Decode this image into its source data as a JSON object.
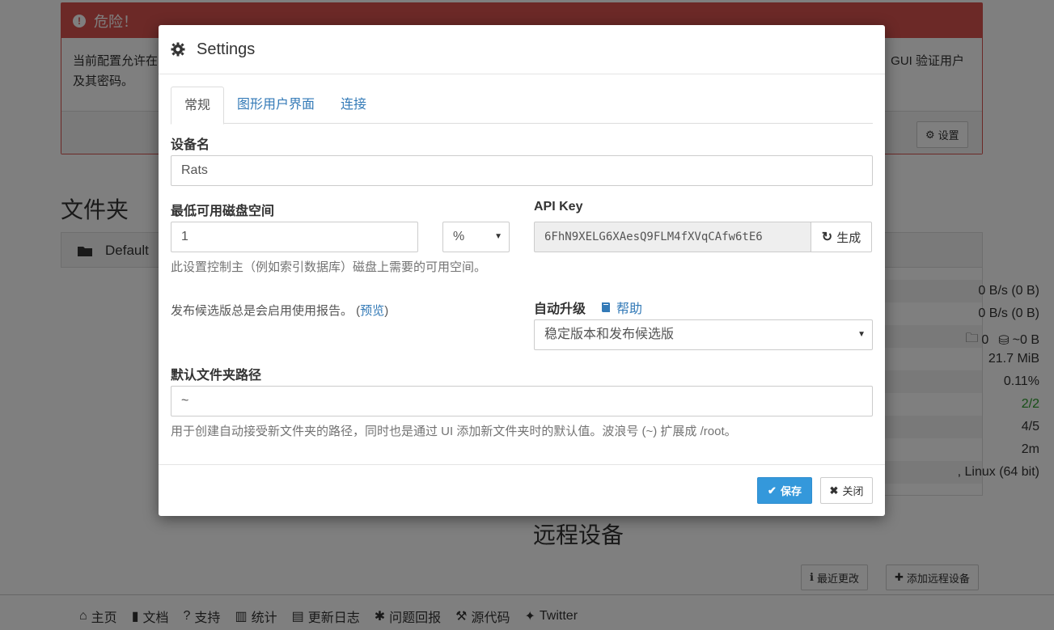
{
  "background": {
    "danger": {
      "title": "危险！",
      "body_left": "当前配置允许在",
      "body_right": "GUI 验证用户",
      "body_line2": "及其密码。",
      "settings_button": "设置"
    },
    "folders_title": "文件夹",
    "folder_name": "Default",
    "device_stats": [
      "0 B/s (0 B)",
      "0 B/s (0 B)",
      "~0 B",
      "21.7 MiB",
      "0.11%",
      "2/2",
      "4/5",
      "2m",
      ", Linux (64 bit)"
    ],
    "device_folder_count": "0",
    "remote_devices_title": "远程设备",
    "recent_changes_button": "最近更改",
    "add_remote_button": "添加远程设备",
    "footer_links": [
      "主页",
      "文档",
      "支持",
      "统计",
      "更新日志",
      "问题回报",
      "源代码",
      "Twitter"
    ]
  },
  "modal": {
    "title": "Settings",
    "tabs": [
      "常规",
      "图形用户界面",
      "连接"
    ],
    "active_tab": "常规",
    "device_name_label": "设备名",
    "device_name_value": "Rats",
    "min_disk_label": "最低可用磁盘空间",
    "min_disk_value": "1",
    "min_disk_unit": "%",
    "min_disk_help": "此设置控制主（例如索引数据库）磁盘上需要的可用空间。",
    "api_key_label": "API Key",
    "api_key_value": "6FhN9XELG6XAesQ9FLM4fXVqCAfw6tE6",
    "generate_button": "生成",
    "rc_help_text": "发布候选版总是会启用使用报告。 (",
    "rc_help_link": "预览",
    "rc_help_close": ")",
    "auto_upgrade_label": "自动升级",
    "help_link": "帮助",
    "auto_upgrade_value": "稳定版本和发布候选版",
    "default_path_label": "默认文件夹路径",
    "default_path_value": "~",
    "default_path_help": "用于创建自动接受新文件夹的路径，同时也是通过 UI 添加新文件夹时的默认值。波浪号 (~) 扩展成 /root。",
    "save_button": "保存",
    "close_button": "关闭"
  },
  "colors": {
    "danger": "#d9534f",
    "link": "#337ab7",
    "primary": "#3498db",
    "success_text": "#2a9b2a"
  }
}
